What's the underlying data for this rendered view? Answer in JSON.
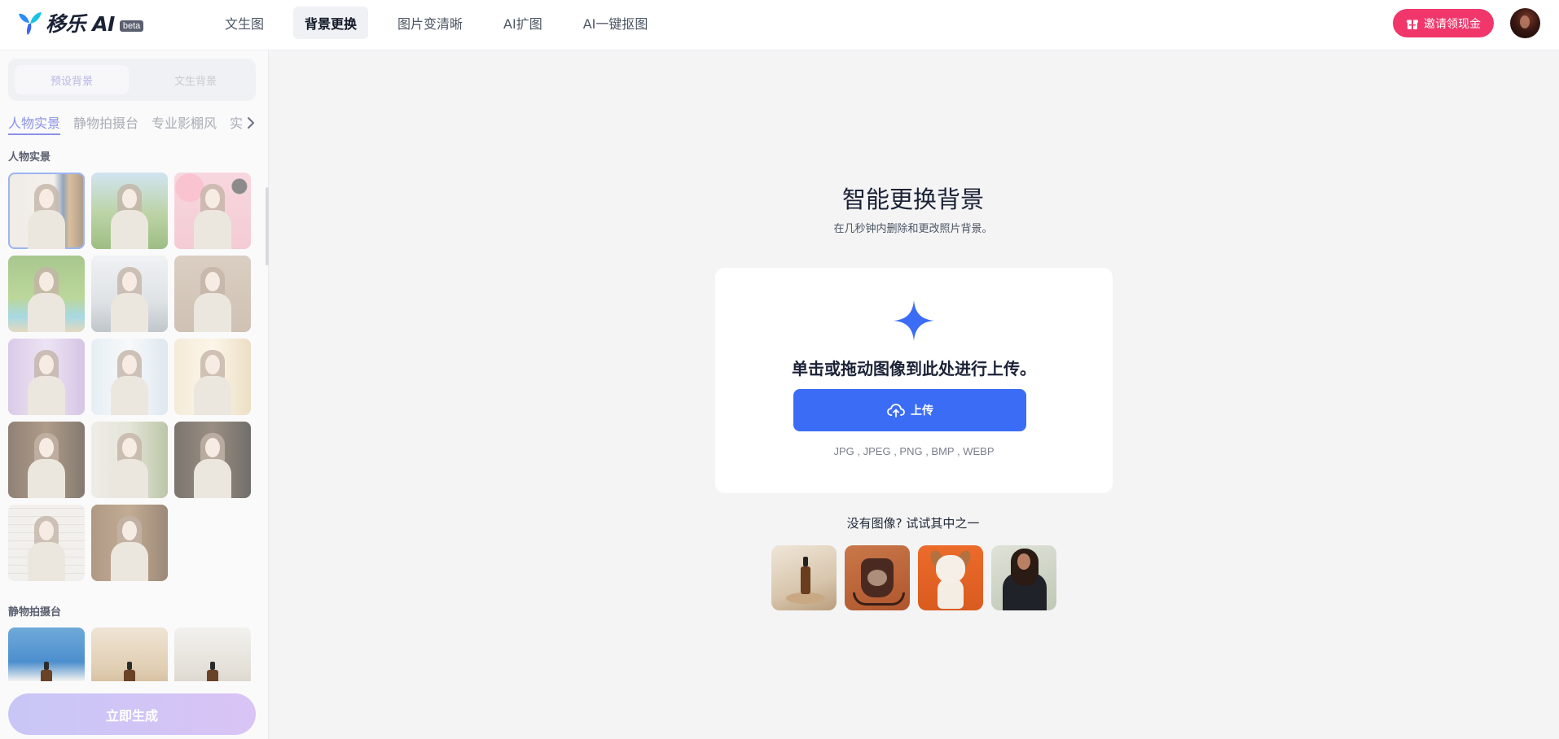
{
  "header": {
    "logo_text": "移乐 AI",
    "logo_badge": "beta",
    "nav": [
      "文生图",
      "背景更换",
      "图片变清晰",
      "AI扩图",
      "AI一键抠图"
    ],
    "nav_active_index": 1,
    "invite_label": "邀请领现金"
  },
  "sidebar": {
    "segments": [
      "预设背景",
      "文生背景"
    ],
    "segment_active_index": 0,
    "category_tabs": [
      "人物实景",
      "静物拍摄台",
      "专业影棚风",
      "实"
    ],
    "category_active_index": 0,
    "section1_title": "人物实景",
    "section1_thumbs": [
      {
        "bg": "bookshelf",
        "selected": true
      },
      {
        "bg": "park"
      },
      {
        "bg": "pink-balloons"
      },
      {
        "bg": "beach-trees"
      },
      {
        "bg": "gym"
      },
      {
        "bg": "beige-wall"
      },
      {
        "bg": "purple-room"
      },
      {
        "bg": "bright-window"
      },
      {
        "bg": "sunny-room"
      },
      {
        "bg": "cafe"
      },
      {
        "bg": "plants"
      },
      {
        "bg": "dark-cafe"
      },
      {
        "bg": "white-brick"
      },
      {
        "bg": "wood-shelf"
      }
    ],
    "section2_title": "静物拍摄台",
    "section2_thumbs": [
      {
        "bg": "seaside"
      },
      {
        "bg": "shelf-studio"
      },
      {
        "bg": "bright-studio"
      }
    ],
    "generate_label": "立即生成"
  },
  "main": {
    "title": "智能更换背景",
    "subtitle": "在几秒钟内删除和更改照片背景。",
    "card_text": "单击或拖动图像到此处进行上传。",
    "upload_label": "上传",
    "formats": "JPG , JPEG , PNG , BMP , WEBP",
    "try_text": "没有图像? 试试其中之一",
    "samples": [
      "bottle",
      "bag",
      "dog",
      "woman"
    ]
  },
  "colors": {
    "accent_blue": "#3b6cf6",
    "invite_pink": "#f1366b",
    "tab_active": "#8a91e6",
    "page_bg": "#f4f4f5"
  },
  "icons": {
    "logo": "leaf-logo-icon",
    "invite": "gift-icon",
    "tabs_next": "chevron-right-icon",
    "upload_sparkle": "sparkle-icon",
    "upload_button": "cloud-upload-icon"
  }
}
